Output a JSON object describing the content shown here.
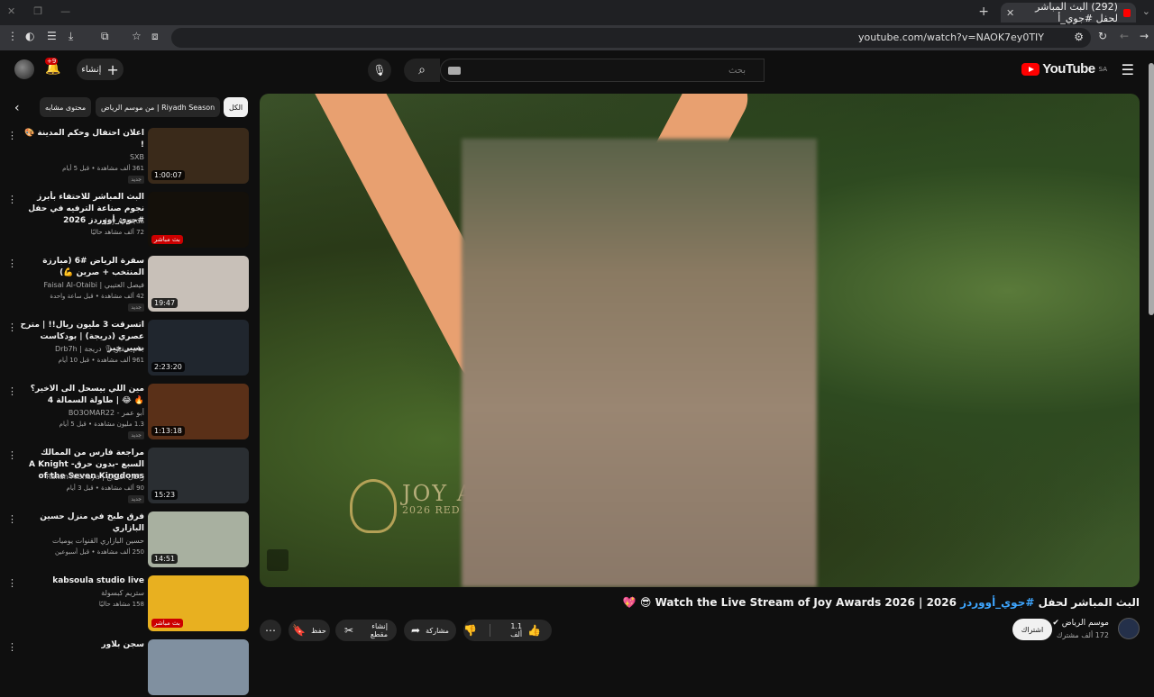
{
  "browser": {
    "tab_title": "(292) البث المباشر لحفل #جوي_أ",
    "url": "youtube.com/watch?v=NAOK7ey0TIY"
  },
  "header": {
    "logo_text": "YouTube",
    "logo_region": "SA",
    "search_placeholder": "بحث",
    "create_label": "إنشاء",
    "notif_badge": "+9"
  },
  "chips": [
    "الكل",
    "من موسم الرياض | Riyadh Season",
    "محتوى مشابه"
  ],
  "video": {
    "title_prefix": "البث المباشر لحفل ",
    "title_tag": "#جوي_أووردز",
    "title_suffix": " 2026 | Watch the Live Stream of Joy Awards 2026 😎 💖",
    "overlay_text": "JOY AWA",
    "overlay_sub": "2026 RED C",
    "channel": "موسم الرياض",
    "subscribers": "172 ألف مشترك",
    "subscribe": "اشتراك",
    "likes": "1.1 ألف",
    "share": "مشاركة",
    "clip": "إنشاء مقطع",
    "save": "حفظ"
  },
  "recommendations": [
    {
      "title": "اعلان احتفال وحكم المدينة 🎨 !",
      "channel": "SXB",
      "meta": "361 ألف مشاهدة • قبل 5 أيام",
      "duration": "1:00:07",
      "live": false,
      "badge": "جديد",
      "color": "#3a2a1a"
    },
    {
      "title": "البث المباشر للاحتفاء بأبرز نجوم صناعة الترفيه في حفل #جوي_أووردز 2026",
      "channel": "Joy Awards",
      "meta": "72 ألف مشاهد حاليًا",
      "duration": "بث مباشر",
      "live": true,
      "badge": "",
      "color": "#14100a"
    },
    {
      "title": "سفرة الرياض #6 (مبارزة المنتخب + صرين 💪)",
      "channel": "فيصل العتيبي | Faisal Al-Otaibi",
      "meta": "42 ألف مشاهدة • قبل ساعة واحدة",
      "duration": "19:47",
      "live": false,
      "badge": "جديد",
      "color": "#c8c0b8"
    },
    {
      "title": "اتسرقت 3 مليون ريال!! | مترح عصري (دريجة) | بودكاست بسير خير",
      "channel": "خام سقيو 🎙 دريجة | Drb7h",
      "meta": "961 ألف مشاهدة • قبل 10 أيام",
      "duration": "2:23:20",
      "live": false,
      "badge": "",
      "color": "#20262e"
    },
    {
      "title": "مين اللي بيسحل الى الاخير؟ 🔥 😂 | طاولة السمالة 4",
      "channel": "أبو عمر - BO3OMAR22",
      "meta": "1.3 مليون مشاهدة • قبل 5 أيام",
      "duration": "1:13:18",
      "live": false,
      "badge": "جديد",
      "color": "#5a3018"
    },
    {
      "title": "مراجعة فارس من الممالك السبع -بدون حرق- A Knight of the Seven Kingdoms",
      "channel": "راكان الشايع | Rakan AlShaya",
      "meta": "90 ألف مشاهدة • قبل 3 أيام",
      "duration": "15:23",
      "live": false,
      "badge": "جديد",
      "color": "#2a2e32"
    },
    {
      "title": "فرق طبخ في منزل حسين البازاري",
      "channel": "حسين البازاري القنوات يوميات",
      "meta": "250 ألف مشاهدة • قبل أسبوعين",
      "duration": "14:51",
      "live": false,
      "badge": "",
      "color": "#a8b0a0"
    },
    {
      "title": "kabsoula studio live",
      "channel": "ستريم كبسولة",
      "meta": "158 مشاهد حاليًا",
      "duration": "بث مباشر",
      "live": true,
      "badge": "",
      "color": "#e8b020"
    },
    {
      "title": "سجن بلاور",
      "channel": "",
      "meta": "",
      "duration": "",
      "live": false,
      "badge": "",
      "color": "#8090a0"
    }
  ]
}
